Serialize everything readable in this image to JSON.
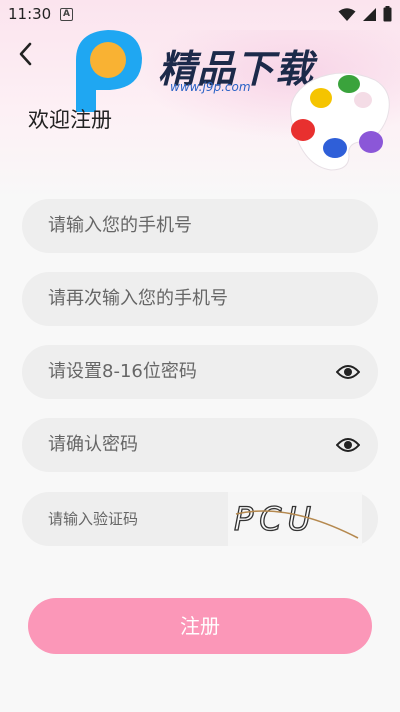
{
  "status_bar": {
    "time": "11:30",
    "notification_letter": "A",
    "icons": [
      "wifi-icon",
      "signal-icon",
      "battery-icon"
    ]
  },
  "header": {
    "back_icon": "chevron-left-icon",
    "logo_text": "精品下载",
    "logo_url": "www.j9p.com",
    "title": "欢迎注册"
  },
  "form": {
    "phone_placeholder": "请输入您的手机号",
    "phone_confirm_placeholder": "请再次输入您的手机号",
    "password_placeholder": "请设置8-16位密码",
    "password_confirm_placeholder": "请确认密码",
    "captcha_placeholder": "请输入验证码",
    "captcha_text": "PCU",
    "visibility_icon": "eye-icon"
  },
  "actions": {
    "register_label": "注册"
  },
  "colors": {
    "accent": "#fb97b8",
    "field_bg": "#eeeeee",
    "header_pink": "#fbe4ee"
  }
}
